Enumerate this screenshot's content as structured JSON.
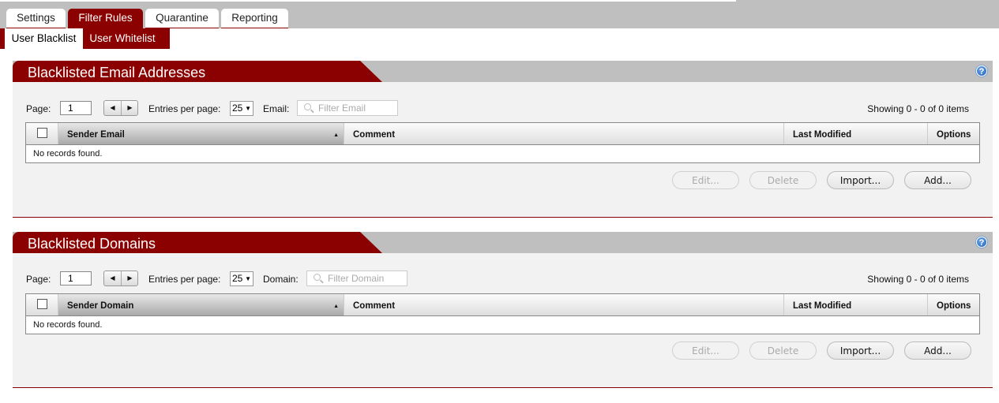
{
  "tabs": [
    {
      "label": "Settings",
      "active": false
    },
    {
      "label": "Filter Rules",
      "active": true
    },
    {
      "label": "Quarantine",
      "active": false
    },
    {
      "label": "Reporting",
      "active": false
    }
  ],
  "subtabs": [
    {
      "label": "User Blacklist",
      "active": true
    },
    {
      "label": "User Whitelist",
      "active": false
    }
  ],
  "accent_color": "#8b0000",
  "panels": [
    {
      "title": "Blacklisted Email Addresses",
      "page_label": "Page:",
      "page_value": "1",
      "prev_icon": "◀",
      "next_icon": "▶",
      "entries_label": "Entries per page:",
      "entries_value": "25",
      "filter_label": "Email:",
      "filter_placeholder": "Filter Email",
      "showing": "Showing 0 - 0 of 0 items",
      "columns": [
        "Sender Email",
        "Comment",
        "Last Modified",
        "Options"
      ],
      "sort_icon": "▲",
      "empty_text": "No records found.",
      "buttons": {
        "edit": "Edit...",
        "delete": "Delete",
        "import": "Import...",
        "add": "Add..."
      }
    },
    {
      "title": "Blacklisted Domains",
      "page_label": "Page:",
      "page_value": "1",
      "prev_icon": "◀",
      "next_icon": "▶",
      "entries_label": "Entries per page:",
      "entries_value": "25",
      "filter_label": "Domain:",
      "filter_placeholder": "Filter Domain",
      "showing": "Showing 0 - 0 of 0 items",
      "columns": [
        "Sender Domain",
        "Comment",
        "Last Modified",
        "Options"
      ],
      "sort_icon": "▲",
      "empty_text": "No records found.",
      "buttons": {
        "edit": "Edit...",
        "delete": "Delete",
        "import": "Import...",
        "add": "Add..."
      }
    }
  ],
  "help_glyph": "?",
  "caret_glyph": "▼"
}
